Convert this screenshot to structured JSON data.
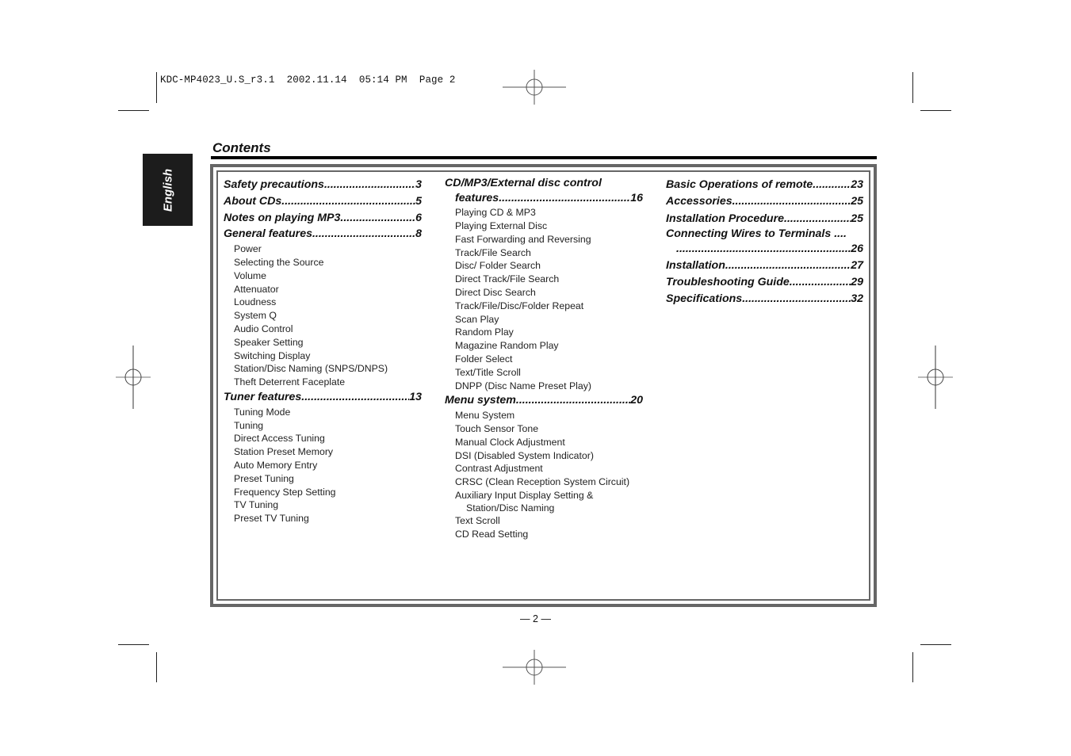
{
  "slug": "KDC-MP4023_U.S_r3.1  2002.11.14  05:14 PM  Page 2",
  "language_tab": "English",
  "title": "Contents",
  "columns": [
    {
      "sections": [
        {
          "label": "Safety precautions",
          "page": "3",
          "items": []
        },
        {
          "label": "About CDs",
          "page": "5",
          "items": []
        },
        {
          "label": "Notes on playing MP3 ",
          "page": "6",
          "items": []
        },
        {
          "label": "General features ",
          "page": "8",
          "items": [
            "Power",
            "Selecting the Source",
            "Volume",
            "Attenuator",
            "Loudness",
            "System Q",
            "Audio Control",
            "Speaker Setting",
            "Switching Display",
            "Station/Disc Naming (SNPS/DNPS)",
            "Theft Deterrent Faceplate"
          ]
        },
        {
          "label": "Tuner features",
          "page": "13",
          "items": [
            "Tuning Mode",
            "Tuning",
            "Direct Access Tuning",
            "Station Preset Memory",
            "Auto Memory Entry",
            "Preset Tuning",
            "Frequency Step Setting",
            "TV Tuning",
            "Preset TV Tuning"
          ]
        }
      ]
    },
    {
      "sections": [
        {
          "label_line1": "CD/MP3/External disc control",
          "label": "features ",
          "page": "16",
          "items": [
            "Playing CD & MP3",
            "Playing External Disc",
            "Fast Forwarding and Reversing",
            "Track/File Search",
            "Disc/ Folder Search",
            "Direct Track/File Search",
            "Direct Disc Search",
            "Track/File/Disc/Folder Repeat",
            "Scan Play",
            "Random Play",
            "Magazine Random Play",
            "Folder Select",
            "Text/Title Scroll",
            "DNPP (Disc Name Preset Play)"
          ]
        },
        {
          "label": "Menu system",
          "page": "20",
          "items": [
            "Menu System",
            "Touch Sensor Tone",
            "Manual Clock Adjustment",
            "DSI (Disabled System Indicator)",
            "Contrast Adjustment",
            "CRSC (Clean Reception System Circuit)",
            "Auxiliary Input Display Setting &",
            "Station/Disc Naming",
            "Text Scroll",
            "CD Read Setting"
          ]
        }
      ]
    },
    {
      "sections": [
        {
          "label": "Basic Operations of remote",
          "page": "23"
        },
        {
          "label": "Accessories",
          "page": "25"
        },
        {
          "label": "Installation Procedure ",
          "page": "25"
        },
        {
          "label_line1": "Connecting Wires to Terminals ....",
          "label": "",
          "page": "26"
        },
        {
          "label": "Installation ",
          "page": "27"
        },
        {
          "label": "Troubleshooting Guide ",
          "page": "29"
        },
        {
          "label": "Specifications ",
          "page": "32"
        }
      ]
    }
  ],
  "footer": "— 2 —"
}
